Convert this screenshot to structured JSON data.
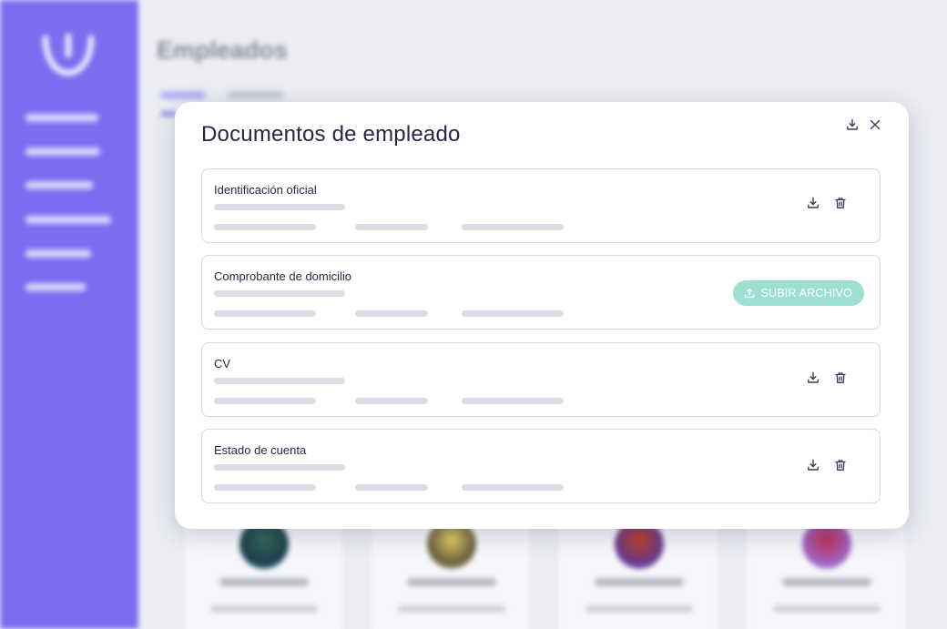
{
  "background": {
    "page_title": "Empleados"
  },
  "modal": {
    "title": "Documentos de empleado",
    "documents": [
      {
        "title": "Identificación oficial",
        "state": "uploaded"
      },
      {
        "title": "Comprobante de domicilio",
        "state": "missing",
        "upload_label": "SUBIR ARCHIVO"
      },
      {
        "title": "CV",
        "state": "uploaded"
      },
      {
        "title": "Estado de cuenta",
        "state": "uploaded"
      }
    ]
  },
  "icons": {
    "download": "download-icon",
    "delete": "trash-icon",
    "close": "close-icon",
    "upload": "upload-icon"
  },
  "colors": {
    "sidebar": "#7b6cf0",
    "title_text": "#26264a",
    "upload_button": "#9edfd4",
    "icon": "#3a3a5a"
  }
}
